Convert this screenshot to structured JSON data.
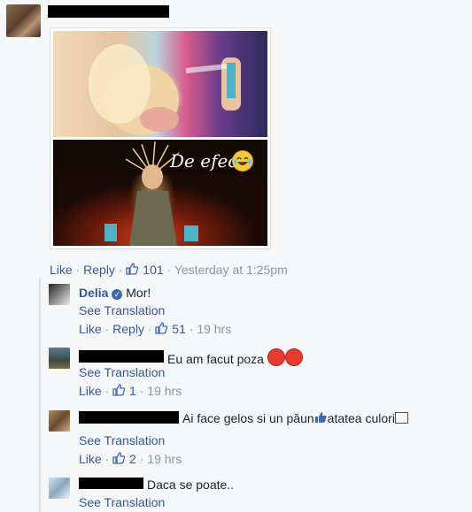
{
  "post": {
    "overlay_text": "De efect",
    "actions": {
      "like": "Like",
      "reply": "Reply",
      "sep": "·",
      "count": "101",
      "time": "Yesterday at 1:25pm"
    }
  },
  "comments": [
    {
      "name": "Delia",
      "verified": true,
      "text": "Mor!",
      "see_translation": "See Translation",
      "like": "Like",
      "reply": "Reply",
      "sep": "·",
      "count": "51",
      "time": "19 hrs"
    },
    {
      "text": "Eu am facut poza",
      "see_translation": "See Translation",
      "like": "Like",
      "sep": "·",
      "count": "1",
      "time": "19 hrs"
    },
    {
      "text": "Ai face gelos si un păun",
      "text_tail": "atatea culori",
      "see_translation": "See Translation",
      "like": "Like",
      "sep": "·",
      "count": "2",
      "time": "19 hrs"
    },
    {
      "text": "Daca se poate..",
      "see_translation": "See Translation"
    }
  ],
  "icons": {
    "like": "thumbs-up-icon",
    "verified": "verified-badge-icon",
    "laugh": "tears-of-joy-emoji",
    "angry": "angry-face-emoji"
  },
  "colors": {
    "link": "#365899",
    "meta": "#90949c",
    "text": "#1d2129",
    "background": "#f6f7f9"
  }
}
